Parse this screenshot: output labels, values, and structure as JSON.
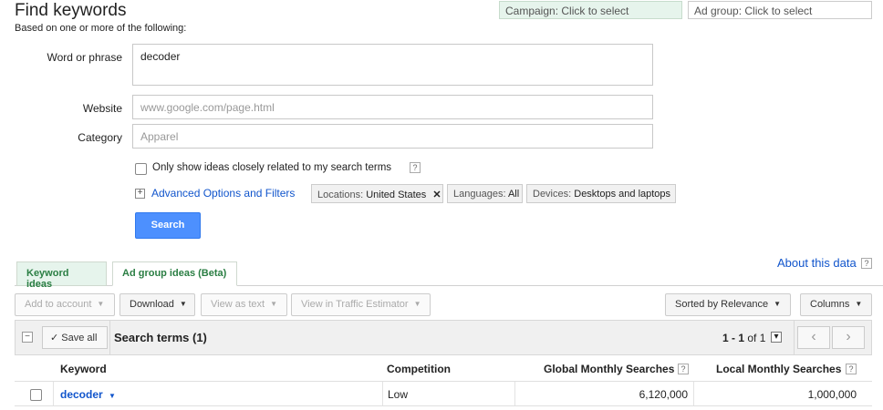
{
  "header": {
    "title": "Find keywords",
    "subtitle": "Based on one or more of the following:",
    "campaign_picker": "Campaign: Click to select",
    "adgroup_picker": "Ad group: Click to select"
  },
  "form": {
    "word_label": "Word or phrase",
    "word_value": "decoder",
    "website_label": "Website",
    "website_placeholder": "www.google.com/page.html",
    "category_label": "Category",
    "category_placeholder": "Apparel",
    "only_show_label": "Only show ideas closely related to my search terms",
    "help_glyph": "?",
    "advanced_link": "Advanced Options and Filters",
    "plus_glyph": "+",
    "filters": {
      "locations_key": "Locations:",
      "locations_value": "United States",
      "remove_glyph": "✕",
      "languages_key": "Languages:",
      "languages_value": "All",
      "devices_key": "Devices:",
      "devices_value": "Desktops and laptops"
    },
    "search_button": "Search"
  },
  "tabs": {
    "keyword_ideas": "Keyword ideas",
    "ad_group_ideas": "Ad group ideas (Beta)"
  },
  "about": {
    "label": "About this data",
    "help_glyph": "?"
  },
  "toolbar": {
    "add_to_account": "Add to account",
    "download": "Download",
    "view_as_text": "View as text",
    "view_traffic": "View in Traffic Estimator",
    "sorted_by": "Sorted by Relevance",
    "columns": "Columns",
    "caret": "▼"
  },
  "grid": {
    "collapse_glyph": "−",
    "check_glyph": "✓",
    "save_all": "Save all",
    "search_terms": "Search terms (1)",
    "pagination_range": "1 - 1",
    "pagination_of": "of 1",
    "dropdown_glyph": "▾",
    "prev_glyph": "‹",
    "next_glyph": "›",
    "columns": {
      "keyword": "Keyword",
      "competition": "Competition",
      "global": "Global Monthly Searches",
      "local": "Local Monthly Searches"
    },
    "rows": [
      {
        "keyword": "decoder",
        "competition": "Low",
        "global": "6,120,000",
        "local": "1,000,000"
      }
    ]
  },
  "colors": {
    "link": "#1155cc",
    "primary_button": "#4d90fe",
    "tab_text": "#2a7e43",
    "tab_bg": "#e6f4ec"
  }
}
